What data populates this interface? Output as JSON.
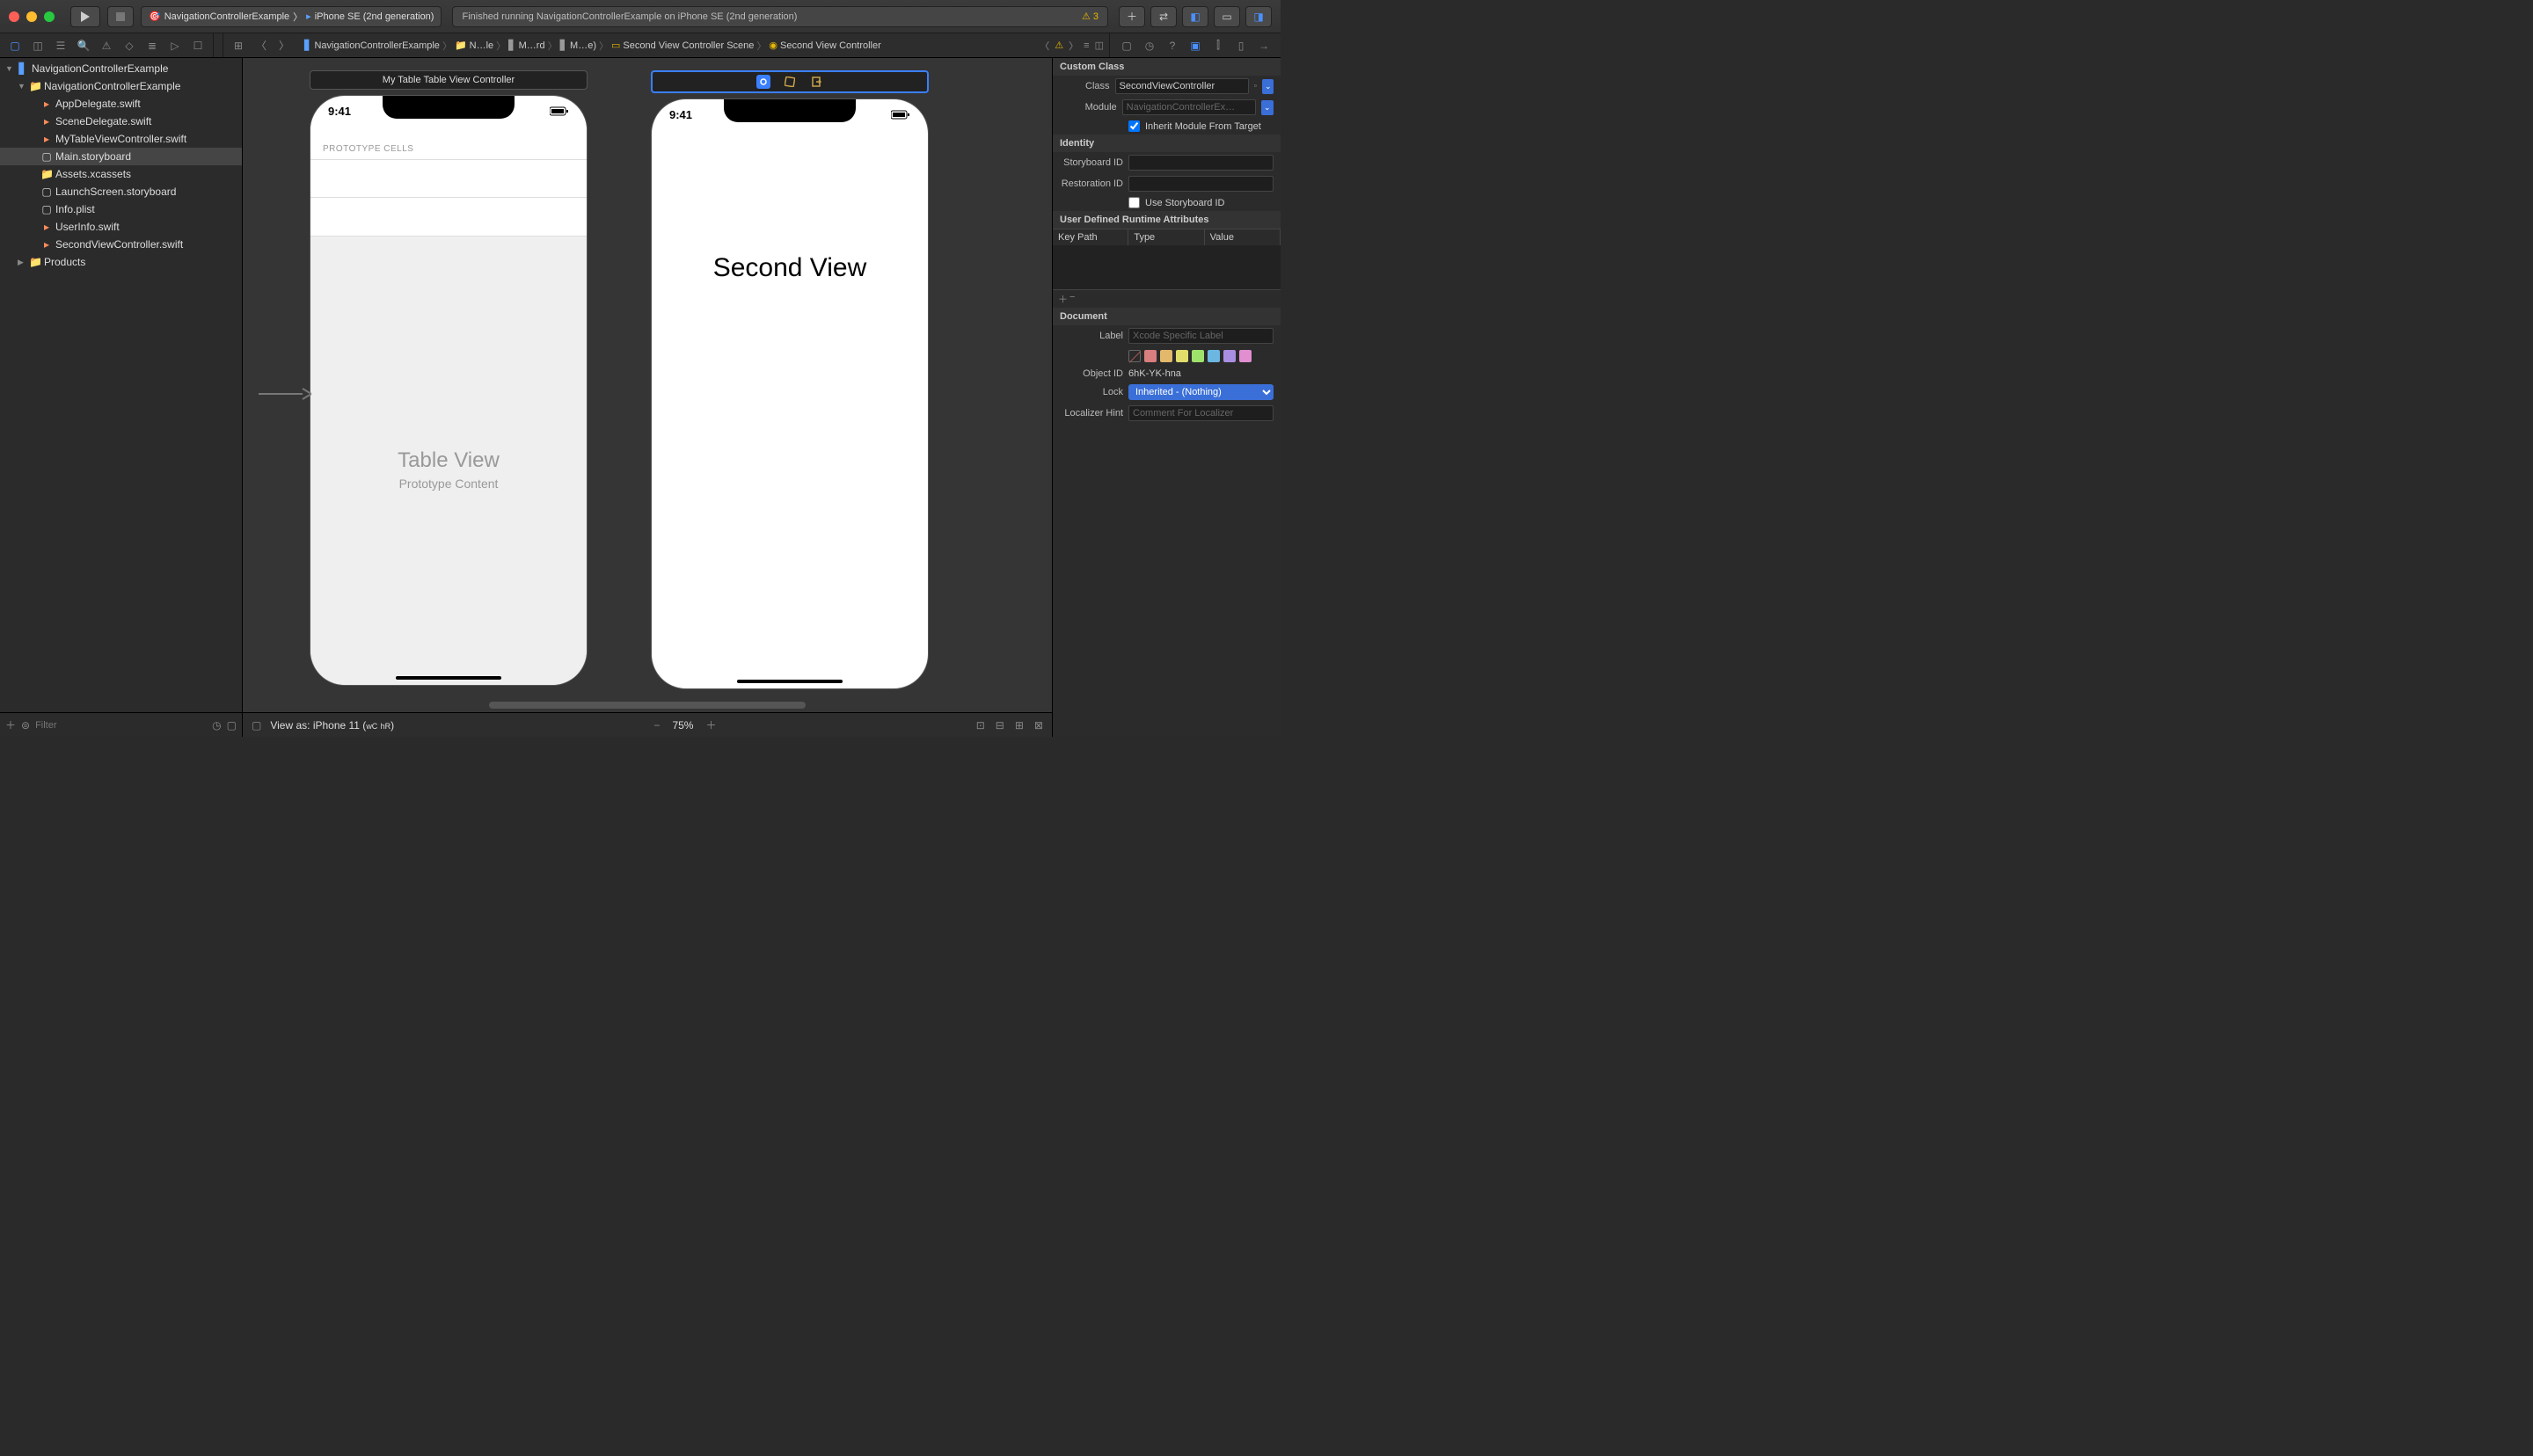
{
  "titlebar": {
    "scheme_project": "NavigationControllerExample",
    "scheme_device": "iPhone SE (2nd generation)",
    "status_text": "Finished running NavigationControllerExample on iPhone SE (2nd generation)",
    "warning_count": "3"
  },
  "jumpbar": {
    "items": [
      "NavigationControllerExample",
      "N…le",
      "M…rd",
      "M…e)",
      "Second View Controller Scene",
      "Second View Controller"
    ]
  },
  "navigator": {
    "root": "NavigationControllerExample",
    "group": "NavigationControllerExample",
    "files": [
      "AppDelegate.swift",
      "SceneDelegate.swift",
      "MyTableViewController.swift",
      "Main.storyboard",
      "Assets.xcassets",
      "LaunchScreen.storyboard",
      "Info.plist",
      "UserInfo.swift",
      "SecondViewController.swift"
    ],
    "selected_index": 3,
    "products": "Products",
    "filter_placeholder": "Filter"
  },
  "canvas": {
    "scene1_title": "My Table Table View Controller",
    "scene2_title": "",
    "status_time": "9:41",
    "prototype_label": "PROTOTYPE CELLS",
    "tableview_title": "Table View",
    "tableview_sub": "Prototype Content",
    "second_label": "Second View",
    "view_as": "View as: iPhone 11 (",
    "view_as_wc": "wC",
    "view_as_hr": "hR",
    "view_as_close": ")",
    "zoom": "75%"
  },
  "inspector": {
    "sections": {
      "custom_class": "Custom Class",
      "identity": "Identity",
      "runtime_attrs": "User Defined Runtime Attributes",
      "document": "Document"
    },
    "class_label": "Class",
    "class_value": "SecondViewController",
    "module_label": "Module",
    "module_placeholder": "NavigationControllerEx…",
    "inherit_label": "Inherit Module From Target",
    "inherit_checked": true,
    "storyboard_id_label": "Storyboard ID",
    "restoration_id_label": "Restoration ID",
    "use_sb_id_label": "Use Storyboard ID",
    "attr_cols": [
      "Key Path",
      "Type",
      "Value"
    ],
    "doc_label_label": "Label",
    "doc_label_placeholder": "Xcode Specific Label",
    "colors": [
      "#d97e7e",
      "#e2b86b",
      "#e2dc6b",
      "#9fe26b",
      "#6bb7e2",
      "#a98fe2",
      "#e28fd1"
    ],
    "object_id_label": "Object ID",
    "object_id_value": "6hK-YK-hna",
    "lock_label": "Lock",
    "lock_value": "Inherited - (Nothing)",
    "loc_hint_label": "Localizer Hint",
    "loc_hint_placeholder": "Comment For Localizer"
  }
}
